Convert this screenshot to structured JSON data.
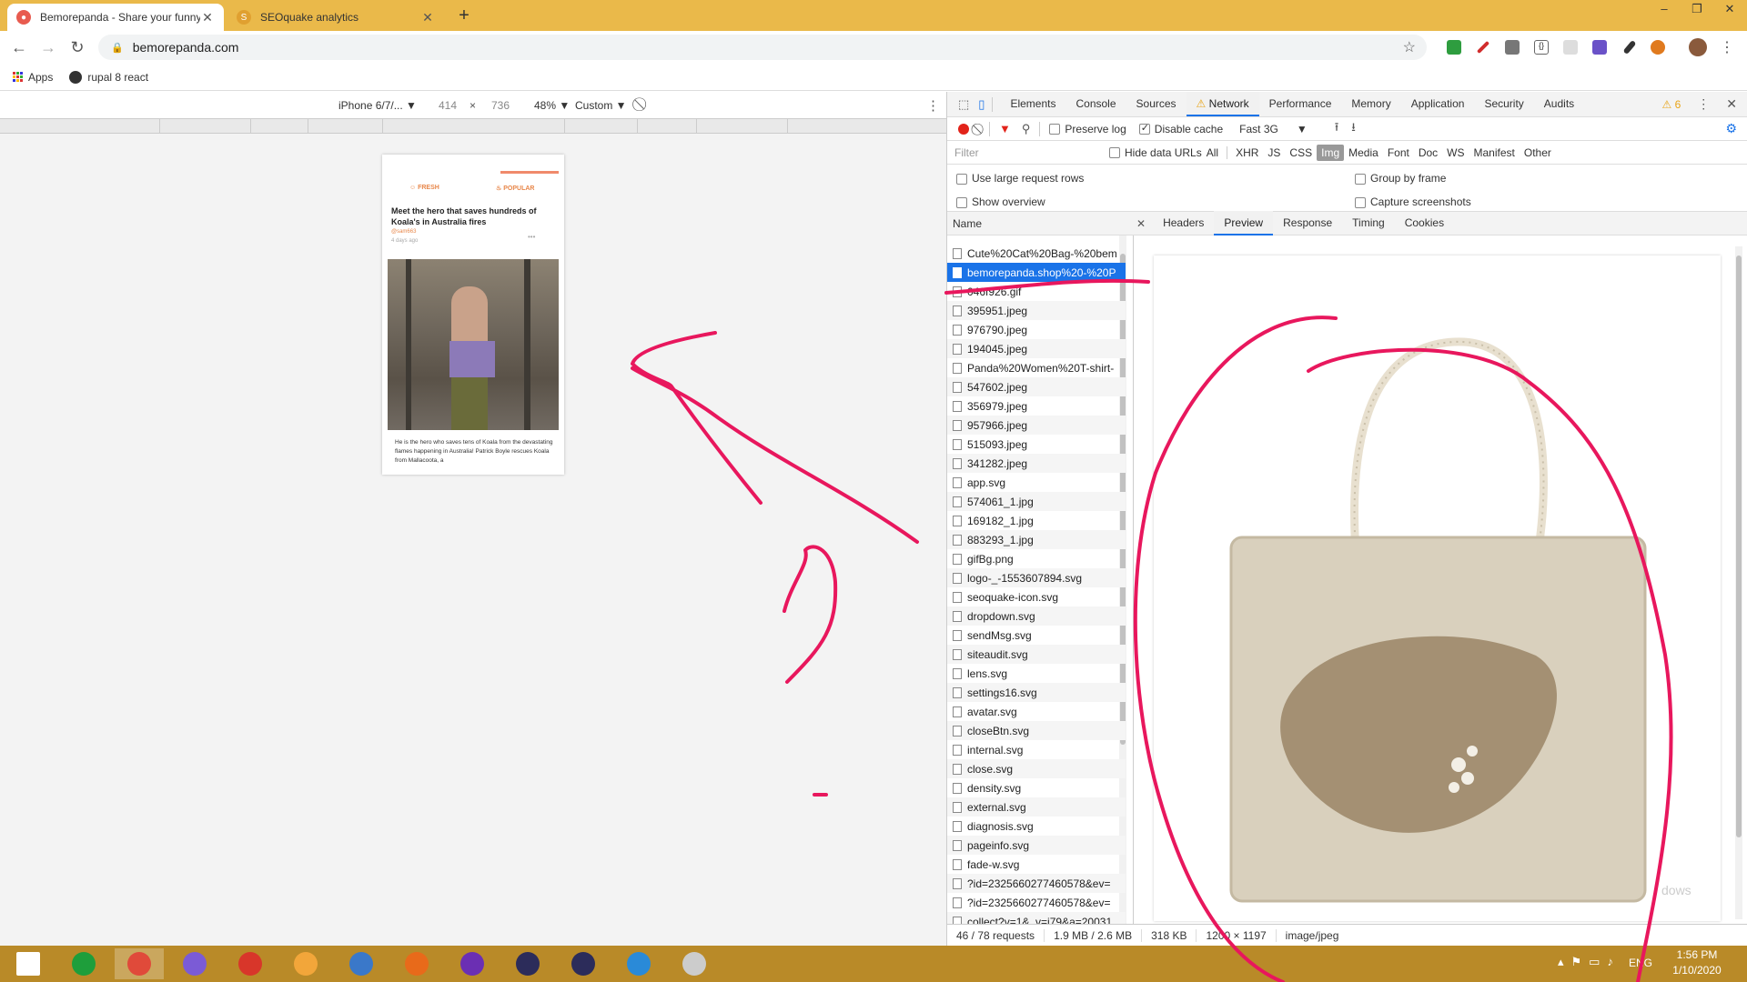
{
  "browser": {
    "tabs": [
      {
        "title": "Bemorepanda - Share your funny",
        "active": true
      },
      {
        "title": "SEOquake analytics",
        "active": false
      }
    ],
    "new_tab": "+",
    "url": "bemorepanda.com",
    "window_controls": [
      "–",
      "❐",
      "✕"
    ]
  },
  "bookmarks": [
    {
      "label": "Apps",
      "icon": "apps-grid-icon"
    },
    {
      "label": "rupal 8 react",
      "icon": "github-icon"
    }
  ],
  "device_toolbar": {
    "device": "iPhone 6/7/...",
    "width": "414",
    "times": "×",
    "height": "736",
    "zoom": "48%",
    "throttle": "Custom"
  },
  "phone_page": {
    "tabs": [
      "FRESH",
      "POPULAR"
    ],
    "article_title": "Meet the hero that saves hundreds of Koala's in Australia fires",
    "author": "@sam663",
    "time": "4 days ago",
    "body": "He is the hero who saves tens of Koala from the devastating flames happening in Australia! Patrick Boyle rescues Koala from Mallacoota, a"
  },
  "devtools": {
    "tabs": [
      "Elements",
      "Console",
      "Sources",
      "Network",
      "Performance",
      "Memory",
      "Application",
      "Security",
      "Audits"
    ],
    "selected_tab": "Network",
    "warnings": "6",
    "toolbar": {
      "preserve_log": "Preserve log",
      "disable_cache": "Disable cache",
      "throttle": "Fast 3G"
    },
    "filter_placeholder": "Filter",
    "hide_data_urls": "Hide data URLs",
    "types": [
      "All",
      "XHR",
      "JS",
      "CSS",
      "Img",
      "Media",
      "Font",
      "Doc",
      "WS",
      "Manifest",
      "Other"
    ],
    "selected_type": "Img",
    "options": {
      "large_rows": "Use large request rows",
      "group_by_frame": "Group by frame",
      "show_overview": "Show overview",
      "capture_screenshots": "Capture screenshots"
    },
    "name_header": "Name",
    "detail_tabs": [
      "Headers",
      "Preview",
      "Response",
      "Timing",
      "Cookies"
    ],
    "selected_detail_tab": "Preview",
    "requests": [
      "Cute%20Cat%20Bag-%20bem",
      "bemorepanda.shop%20-%20P",
      "046f926.gif",
      "395951.jpeg",
      "976790.jpeg",
      "194045.jpeg",
      "Panda%20Women%20T-shirt-",
      "547602.jpeg",
      "356979.jpeg",
      "957966.jpeg",
      "515093.jpeg",
      "341282.jpeg",
      "app.svg",
      "574061_1.jpg",
      "169182_1.jpg",
      "883293_1.jpg",
      "gifBg.png",
      "logo-_-1553607894.svg",
      "seoquake-icon.svg",
      "dropdown.svg",
      "sendMsg.svg",
      "siteaudit.svg",
      "lens.svg",
      "settings16.svg",
      "avatar.svg",
      "closeBtn.svg",
      "internal.svg",
      "close.svg",
      "density.svg",
      "external.svg",
      "diagnosis.svg",
      "pageinfo.svg",
      "fade-w.svg",
      "?id=2325660277460578&ev=",
      "?id=2325660277460578&ev=",
      "collect?v=1&_v=j79&a=20031"
    ],
    "selected_request": 1,
    "status": {
      "requests": "46 / 78 requests",
      "transferred": "1.9 MB / 2.6 MB",
      "size": "318 KB",
      "dims": "1200 × 1197",
      "mime": "image/jpeg"
    },
    "watermark": "dows"
  },
  "taskbar": {
    "icons": [
      "windows-start-icon",
      "store-icon",
      "chrome-icon",
      "viber-icon",
      "rubik-icon",
      "keepass-icon",
      "virtualbox-icon",
      "firefox-icon",
      "tor-icon",
      "eclipse-icon",
      "eclipse-icon-2",
      "vscode-icon",
      "photo-app-icon"
    ],
    "lang": "ENG",
    "time": "1:56 PM",
    "date": "1/10/2020"
  },
  "colors": {
    "tabstrip": "#eab94a",
    "taskbar": "#b98a28",
    "accent": "#1a73e8",
    "ink": "#e8175d"
  }
}
